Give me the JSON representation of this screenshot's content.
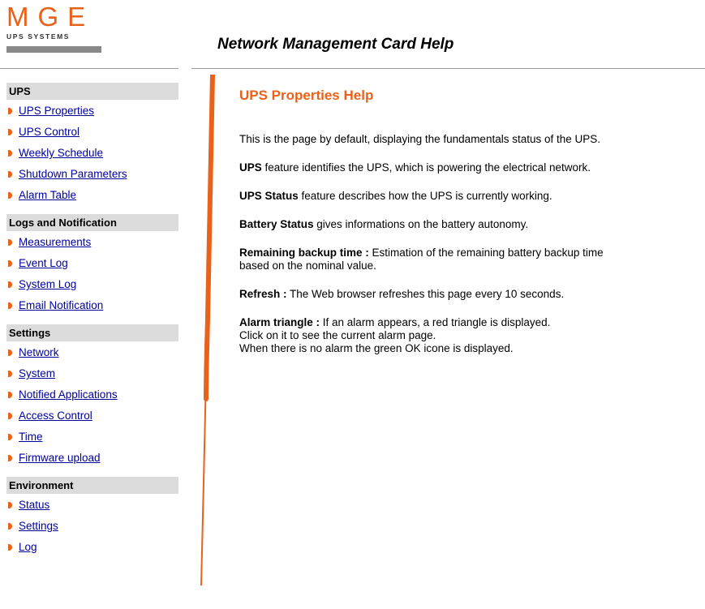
{
  "logo": {
    "letters": "MGE",
    "subtitle": "UPS SYSTEMS"
  },
  "header": {
    "title": "Network Management Card Help"
  },
  "sidebar": {
    "sections": [
      {
        "title": "UPS",
        "items": [
          "UPS Properties",
          "UPS Control",
          "Weekly Schedule",
          "Shutdown Parameters",
          "Alarm Table"
        ]
      },
      {
        "title": "Logs and Notification",
        "items": [
          "Measurements",
          "Event Log",
          "System Log",
          "Email Notification"
        ]
      },
      {
        "title": "Settings",
        "items": [
          "Network",
          "System",
          "Notified Applications",
          "Access Control",
          "Time",
          "Firmware upload"
        ]
      },
      {
        "title": "Environment",
        "items": [
          "Status",
          "Settings",
          "Log"
        ]
      }
    ]
  },
  "content": {
    "title": "UPS Properties Help",
    "intro": "This is the page by default, displaying the fundamentals status of the UPS.",
    "items": [
      {
        "term": "UPS",
        "text": " feature identifies the UPS, which is powering the electrical network."
      },
      {
        "term": "UPS Status",
        "text": " feature describes how the UPS is currently working."
      },
      {
        "term": "Battery Status",
        "text": " gives informations on the battery autonomy."
      },
      {
        "term": "Remaining backup time :",
        "text": " Estimation of the remaining battery backup time",
        "text2": "based on the nominal value."
      },
      {
        "term": "Refresh :",
        "text": " The Web browser refreshes this page every 10 seconds."
      },
      {
        "term": "Alarm triangle :",
        "text": " If an alarm appears, a red triangle is displayed.",
        "text2": "Click on it to see the current alarm page.",
        "text3": "When there is no alarm the green OK icone is displayed."
      }
    ]
  },
  "colors": {
    "accent": "#e8621b",
    "link": "#00009c",
    "section_bg": "#dcdcdc"
  }
}
